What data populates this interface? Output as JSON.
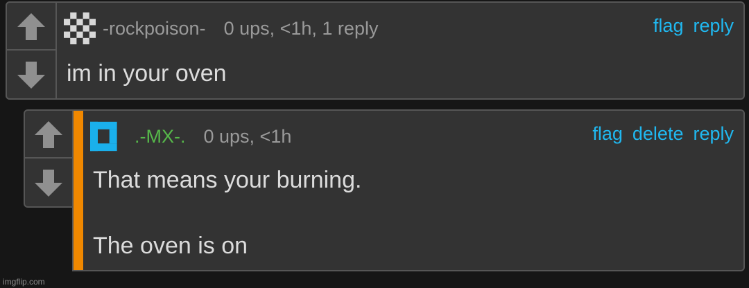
{
  "comments": [
    {
      "username": "-rockpoison-",
      "stats": "0 ups, <1h, 1 reply",
      "actions": [
        "flag",
        "reply"
      ],
      "text": "im in your oven",
      "avatar_icon": "checkered-avatar-icon"
    },
    {
      "username": ".-MX-.",
      "stats": "0 ups, <1h",
      "actions": [
        "flag",
        "delete",
        "reply"
      ],
      "text_line1": "That means your burning.",
      "text_line2": "The oven is on",
      "avatar_icon": "blue-bracket-avatar-icon"
    }
  ],
  "colors": {
    "link": "#20b8f0",
    "mod_username": "#56b84a",
    "highlight": "#f08800"
  },
  "watermark": "imgflip.com"
}
